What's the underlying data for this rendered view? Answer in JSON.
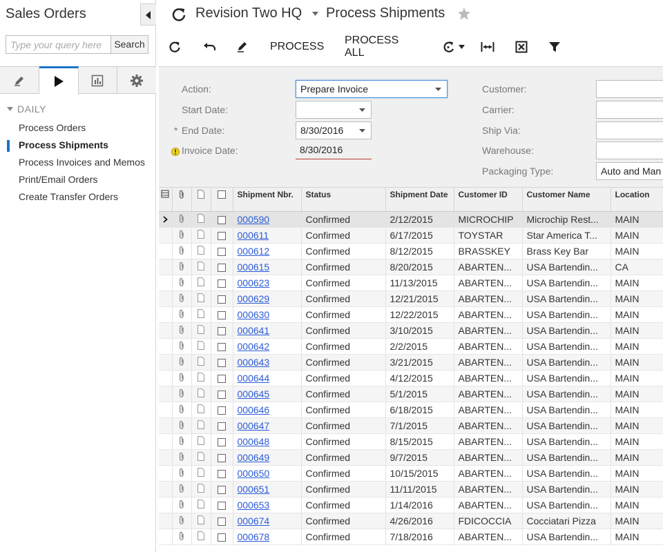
{
  "sidebar": {
    "title": "Sales Orders",
    "search_placeholder": "Type your query here",
    "search_button": "Search",
    "section": "DAILY",
    "items": [
      {
        "label": "Process Orders"
      },
      {
        "label": "Process Shipments"
      },
      {
        "label": "Process Invoices and Memos"
      },
      {
        "label": "Print/Email Orders"
      },
      {
        "label": "Create Transfer Orders"
      }
    ]
  },
  "header": {
    "company": "Revision Two HQ",
    "screen": "Process Shipments"
  },
  "toolbar": {
    "process": "PROCESS",
    "process_all": "PROCESS ALL"
  },
  "filter": {
    "action_label": "Action:",
    "action_value": "Prepare Invoice",
    "start_date_label": "Start Date:",
    "start_date_value": "",
    "end_date_label": "End Date:",
    "end_date_value": "8/30/2016",
    "required_mark": "*",
    "invoice_date_label": "Invoice Date:",
    "invoice_date_value": "8/30/2016",
    "customer_label": "Customer:",
    "carrier_label": "Carrier:",
    "ship_via_label": "Ship Via:",
    "warehouse_label": "Warehouse:",
    "packaging_label": "Packaging Type:",
    "packaging_value": "Auto and Man"
  },
  "grid": {
    "headers": {
      "shipment_nbr": "Shipment Nbr.",
      "status": "Status",
      "shipment_date": "Shipment Date",
      "customer_id": "Customer ID",
      "customer_name": "Customer Name",
      "location": "Location"
    },
    "rows": [
      [
        "000590",
        "Confirmed",
        "2/12/2015",
        "MICROCHIP",
        "Microchip Rest...",
        "MAIN"
      ],
      [
        "000611",
        "Confirmed",
        "6/17/2015",
        "TOYSTAR",
        "Star America T...",
        "MAIN"
      ],
      [
        "000612",
        "Confirmed",
        "8/12/2015",
        "BRASSKEY",
        "Brass Key Bar",
        "MAIN"
      ],
      [
        "000615",
        "Confirmed",
        "8/20/2015",
        "ABARTEN...",
        "USA Bartendin...",
        "CA"
      ],
      [
        "000623",
        "Confirmed",
        "11/13/2015",
        "ABARTEN...",
        "USA Bartendin...",
        "MAIN"
      ],
      [
        "000629",
        "Confirmed",
        "12/21/2015",
        "ABARTEN...",
        "USA Bartendin...",
        "MAIN"
      ],
      [
        "000630",
        "Confirmed",
        "12/22/2015",
        "ABARTEN...",
        "USA Bartendin...",
        "MAIN"
      ],
      [
        "000641",
        "Confirmed",
        "3/10/2015",
        "ABARTEN...",
        "USA Bartendin...",
        "MAIN"
      ],
      [
        "000642",
        "Confirmed",
        "2/2/2015",
        "ABARTEN...",
        "USA Bartendin...",
        "MAIN"
      ],
      [
        "000643",
        "Confirmed",
        "3/21/2015",
        "ABARTEN...",
        "USA Bartendin...",
        "MAIN"
      ],
      [
        "000644",
        "Confirmed",
        "4/12/2015",
        "ABARTEN...",
        "USA Bartendin...",
        "MAIN"
      ],
      [
        "000645",
        "Confirmed",
        "5/1/2015",
        "ABARTEN...",
        "USA Bartendin...",
        "MAIN"
      ],
      [
        "000646",
        "Confirmed",
        "6/18/2015",
        "ABARTEN...",
        "USA Bartendin...",
        "MAIN"
      ],
      [
        "000647",
        "Confirmed",
        "7/1/2015",
        "ABARTEN...",
        "USA Bartendin...",
        "MAIN"
      ],
      [
        "000648",
        "Confirmed",
        "8/15/2015",
        "ABARTEN...",
        "USA Bartendin...",
        "MAIN"
      ],
      [
        "000649",
        "Confirmed",
        "9/7/2015",
        "ABARTEN...",
        "USA Bartendin...",
        "MAIN"
      ],
      [
        "000650",
        "Confirmed",
        "10/15/2015",
        "ABARTEN...",
        "USA Bartendin...",
        "MAIN"
      ],
      [
        "000651",
        "Confirmed",
        "11/11/2015",
        "ABARTEN...",
        "USA Bartendin...",
        "MAIN"
      ],
      [
        "000653",
        "Confirmed",
        "1/14/2016",
        "ABARTEN...",
        "USA Bartendin...",
        "MAIN"
      ],
      [
        "000674",
        "Confirmed",
        "4/26/2016",
        "FDICOCCIA",
        "Cocciatari Pizza",
        "MAIN"
      ],
      [
        "000678",
        "Confirmed",
        "7/18/2016",
        "ABARTEN...",
        "USA Bartendin...",
        "MAIN"
      ]
    ]
  }
}
